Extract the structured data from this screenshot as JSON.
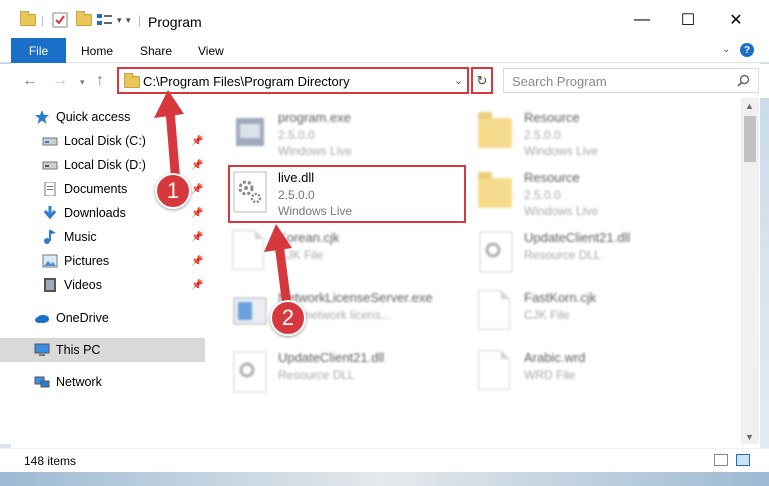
{
  "window": {
    "title": "Program",
    "minimize": "—",
    "maximize": "☐",
    "close": "✕"
  },
  "ribbon": {
    "file_tab": "File",
    "tabs": [
      "Home",
      "Share",
      "View"
    ],
    "help": "?"
  },
  "nav": {
    "address": "C:\\Program Files\\Program Directory",
    "search_placeholder": "Search Program"
  },
  "sidebar": {
    "items": [
      {
        "label": "Quick access",
        "icon": "star-icon"
      },
      {
        "label": "Local Disk (C:)",
        "icon": "drive-icon",
        "pinned": true
      },
      {
        "label": "Local Disk (D:)",
        "icon": "drive-icon",
        "pinned": true
      },
      {
        "label": "Documents",
        "icon": "documents-icon",
        "pinned": true
      },
      {
        "label": "Downloads",
        "icon": "downloads-icon",
        "pinned": true
      },
      {
        "label": "Music",
        "icon": "music-icon",
        "pinned": true
      },
      {
        "label": "Pictures",
        "icon": "pictures-icon",
        "pinned": true
      },
      {
        "label": "Videos",
        "icon": "videos-icon",
        "pinned": true
      },
      {
        "label": "OneDrive",
        "icon": "cloud-icon"
      },
      {
        "label": "This PC",
        "icon": "computer-icon",
        "selected": true
      },
      {
        "label": "Network",
        "icon": "network-icon"
      }
    ]
  },
  "files": [
    {
      "name": "program.exe",
      "line1": "2.5.0.0",
      "line2": "Windows Live",
      "kind": "exe"
    },
    {
      "name": "Resource",
      "line1": "2.5.0.0",
      "line2": "Windows Live",
      "kind": "folder"
    },
    {
      "name": "live.dll",
      "line1": "2.5.0.0",
      "line2": "Windows Live",
      "kind": "dll"
    },
    {
      "name": "Resource",
      "line1": "2.5.0.0",
      "line2": "Windows Live",
      "kind": "folder"
    },
    {
      "name": "Korean.cjk",
      "line1": "CJK File",
      "line2": "",
      "kind": "doc"
    },
    {
      "name": "UpdateClient21.dll",
      "line1": "Resource DLL",
      "line2": "",
      "kind": "dll"
    },
    {
      "name": "NetworkLicenseServer.exe",
      "line1": "NLS network licens...",
      "line2": "",
      "kind": "exe"
    },
    {
      "name": "FastKorn.cjk",
      "line1": "CJK File",
      "line2": "",
      "kind": "doc"
    },
    {
      "name": "UpdateClient21.dll",
      "line1": "Resource DLL",
      "line2": "",
      "kind": "dll"
    },
    {
      "name": "Arabic.wrd",
      "line1": "WRD File",
      "line2": "",
      "kind": "doc"
    }
  ],
  "status": {
    "item_count": "148 items"
  },
  "annotations": {
    "badge1": "1",
    "badge2": "2",
    "highlight_color": "#d6383d"
  }
}
